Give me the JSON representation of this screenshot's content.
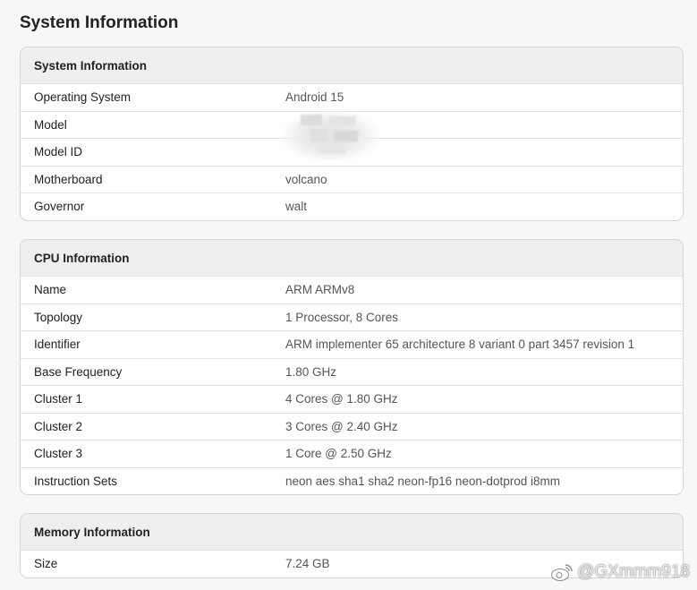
{
  "page": {
    "title": "System Information"
  },
  "system": {
    "header": "System Information",
    "rows": [
      {
        "label": "Operating System",
        "value": "Android 15"
      },
      {
        "label": "Model",
        "value": ""
      },
      {
        "label": "Model ID",
        "value": ""
      },
      {
        "label": "Motherboard",
        "value": "volcano"
      },
      {
        "label": "Governor",
        "value": "walt"
      }
    ]
  },
  "cpu": {
    "header": "CPU Information",
    "rows": [
      {
        "label": "Name",
        "value": "ARM ARMv8"
      },
      {
        "label": "Topology",
        "value": "1 Processor, 8 Cores"
      },
      {
        "label": "Identifier",
        "value": "ARM implementer 65 architecture 8 variant 0 part 3457 revision 1"
      },
      {
        "label": "Base Frequency",
        "value": "1.80 GHz"
      },
      {
        "label": "Cluster 1",
        "value": "4 Cores @ 1.80 GHz"
      },
      {
        "label": "Cluster 2",
        "value": "3 Cores @ 2.40 GHz"
      },
      {
        "label": "Cluster 3",
        "value": "1 Core @ 2.50 GHz"
      },
      {
        "label": "Instruction Sets",
        "value": "neon aes sha1 sha2 neon-fp16 neon-dotprod i8mm"
      }
    ]
  },
  "memory": {
    "header": "Memory Information",
    "rows": [
      {
        "label": "Size",
        "value": "7.24 GB"
      }
    ]
  },
  "watermark": {
    "text": "@GXmmm918",
    "icon": "weibo-icon"
  }
}
